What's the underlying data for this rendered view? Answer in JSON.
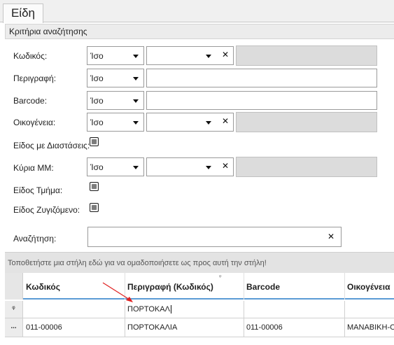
{
  "tab": {
    "label": "Είδη"
  },
  "criteria": {
    "header": "Κριτήρια αναζήτησης",
    "code": {
      "label": "Κωδικός:",
      "operator": "Ίσο"
    },
    "description": {
      "label": "Περιγραφή:",
      "operator": "Ίσο"
    },
    "barcode": {
      "label": "Barcode:",
      "operator": "Ίσο"
    },
    "family": {
      "label": "Οικογένεια:",
      "operator": "Ίσο"
    },
    "dimensions": {
      "label": "Είδος με Διαστάσεις:"
    },
    "unit": {
      "label": "Κύρια ΜΜ:",
      "operator": "Ίσο"
    },
    "section_item": {
      "label": "Είδος Τμήμα:"
    },
    "weighted": {
      "label": "Είδος Ζυγιζόμενο:"
    },
    "search": {
      "label": "Αναζήτηση:",
      "value": ""
    }
  },
  "grid": {
    "group_hint": "Τοποθετήστε μια στήλη εδώ για να ομαδοποιήσετε ως προς αυτή την στήλη!",
    "columns": [
      "Κωδικός",
      "Περιγραφή (Κωδικός)",
      "Barcode",
      "Οικογένεια"
    ],
    "filter_row": {
      "indicator": "ᵠ",
      "description_filter": "ΠΟΡΤΟΚΑΛ"
    },
    "rows": [
      {
        "indicator": "...",
        "code": "011-00006",
        "description": "ΠΟΡΤΟΚΑΛΙΑ",
        "barcode": "011-00006",
        "family": "ΜΑΝΑΒΙΚΗ-Ο"
      }
    ]
  },
  "colors": {
    "accent": "#5b9bd5",
    "annotation_arrow": "#e02020"
  }
}
